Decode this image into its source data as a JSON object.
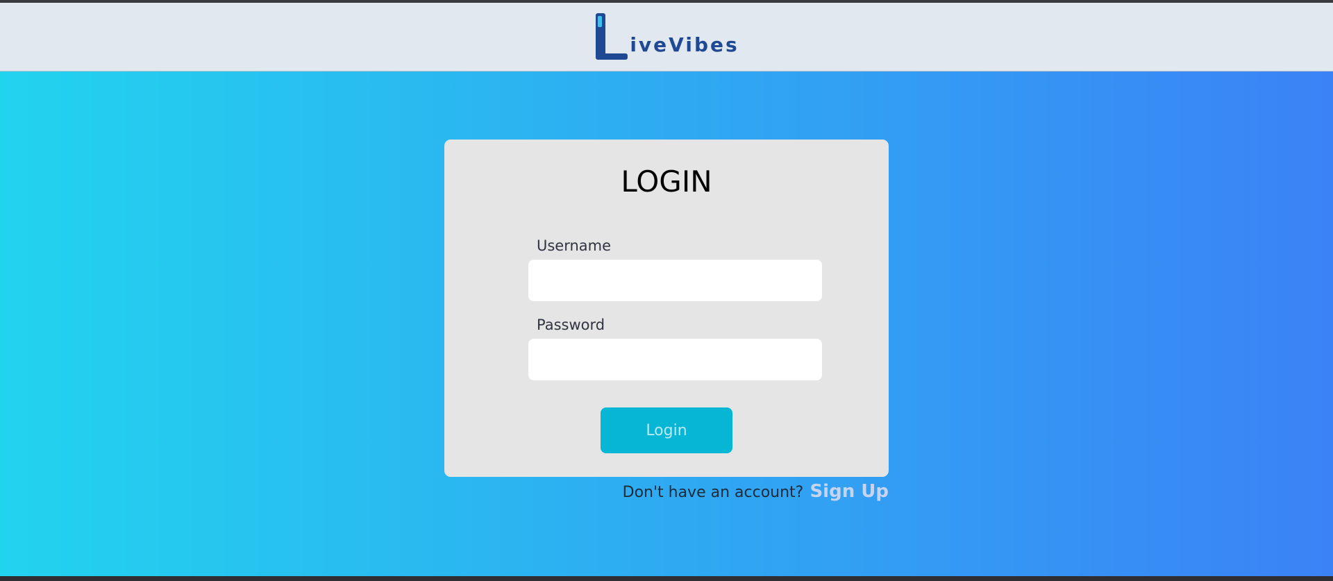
{
  "header": {
    "logo_text": "iveVibes"
  },
  "login_card": {
    "title": "LOGIN",
    "username_label": "Username",
    "username_value": "",
    "password_label": "Password",
    "password_value": "",
    "login_button_label": "Login"
  },
  "signup": {
    "prompt": "Don't have an account?",
    "link_label": "Sign Up"
  },
  "colors": {
    "header_bg": "#e2e8f0",
    "gradient_start": "#22d3ee",
    "gradient_end": "#3b82f6",
    "card_bg": "#e5e5e5",
    "button_bg": "#06b6d4",
    "logo_blue": "#1f4a93"
  }
}
